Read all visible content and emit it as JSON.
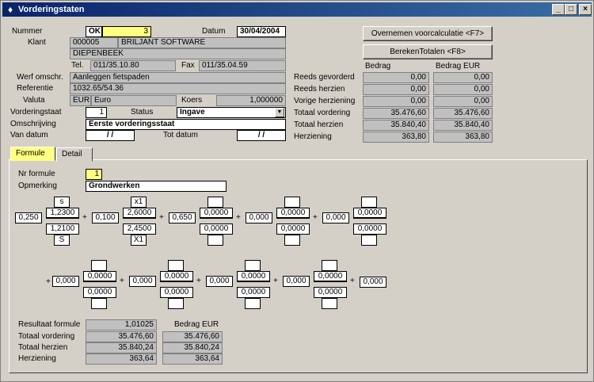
{
  "window": {
    "title": "Vorderingstaten"
  },
  "header": {
    "nummer_label": "Nummer",
    "nummer_status": "OK",
    "nummer_value": "3",
    "datum_label": "Datum",
    "datum_value": "30/04/2004",
    "klant_label": "Klant",
    "klant_code": "000005",
    "klant_name": "BRILJANT SOFTWARE",
    "klant_city": "DIEPENBEEK",
    "tel_label": "Tel.",
    "tel_value": "011/35.10.80",
    "fax_label": "Fax",
    "fax_value": "011/35.04.59",
    "werf_label": "Werf omschr.",
    "werf_value": "Aanleggen fietspaden",
    "ref_label": "Referentie",
    "ref_value": "1032.65/54.36",
    "valuta_label": "Valuta",
    "valuta_code": "EUR",
    "valuta_name": "Euro",
    "koers_label": "Koers",
    "koers_value": "1,000000",
    "staat_label": "Vorderingstaat",
    "staat_value": "1",
    "status_label": "Status",
    "status_value": "Ingave",
    "omschr_label": "Omschrijving",
    "omschr_value": "Eerste vorderingsstaat",
    "van_label": "Van datum",
    "van_value": "/ /",
    "tot_label": "Tot datum",
    "tot_value": "/ /"
  },
  "buttons": {
    "overnemen": "Overnemen voorcalculatie <F7>",
    "bereken": "BerekenTotalen <F8>"
  },
  "totals": {
    "col_bedrag": "Bedrag",
    "col_eur": "Bedrag EUR",
    "rows": [
      {
        "label": "Reeds gevorderd",
        "bedrag": "0,00",
        "eur": "0,00"
      },
      {
        "label": "Reeds herzien",
        "bedrag": "0,00",
        "eur": "0,00"
      },
      {
        "label": "Vorige herziening",
        "bedrag": "0,00",
        "eur": "0,00"
      },
      {
        "label": "Totaal vordering",
        "bedrag": "35.476,60",
        "eur": "35.476,60"
      },
      {
        "label": "Totaal herzien",
        "bedrag": "35.840,40",
        "eur": "35.840,40"
      },
      {
        "label": "Herziening",
        "bedrag": "363,80",
        "eur": "363,80"
      }
    ]
  },
  "tabs": [
    "Formule",
    "Detail"
  ],
  "formule": {
    "nr_label": "Nr formule",
    "nr_value": "1",
    "opm_label": "Opmerking",
    "opm_value": "Grondwerken",
    "row1": [
      {
        "coef": "0,250",
        "top": "s",
        "num": "1,2300",
        "den": "1,2100",
        "bot": "S",
        "op": "+"
      },
      {
        "coef": "0,100",
        "top": "x1",
        "num": "2,6000",
        "den": "2,4500",
        "bot": "X1",
        "op": "+"
      },
      {
        "coef": "0,650",
        "top": "",
        "num": "0,0000",
        "den": "0,0000",
        "bot": "",
        "op": "+"
      },
      {
        "coef": "0,000",
        "top": "",
        "num": "0,0000",
        "den": "0,0000",
        "bot": "",
        "op": "+"
      },
      {
        "coef": "0,000",
        "top": "",
        "num": "0,0000",
        "den": "0,0000",
        "bot": "",
        "op": ""
      }
    ],
    "row2": [
      {
        "coef": "0,000",
        "top": "",
        "num": "0,0000",
        "den": "0,0000",
        "bot": "",
        "op": "+"
      },
      {
        "coef": "0,000",
        "top": "",
        "num": "0,0000",
        "den": "0,0000",
        "bot": "",
        "op": "+"
      },
      {
        "coef": "0,000",
        "top": "",
        "num": "0,0000",
        "den": "0,0000",
        "bot": "",
        "op": "+"
      },
      {
        "coef": "0,000",
        "top": "",
        "num": "0,0000",
        "den": "0,0000",
        "bot": "",
        "op": "+"
      }
    ],
    "row2_lead_op": "+",
    "row2_tail": "0,000",
    "result_label": "Resultaat formule",
    "result_value": "1,01025",
    "result_col": "Bedrag EUR",
    "sum_rows": [
      {
        "label": "Totaal vordering",
        "a": "35.476,60",
        "b": "35.476,60"
      },
      {
        "label": "Totaal herzien",
        "a": "35.840,24",
        "b": "35.840,24"
      },
      {
        "label": "Herziening",
        "a": "363,64",
        "b": "363,64"
      }
    ]
  }
}
